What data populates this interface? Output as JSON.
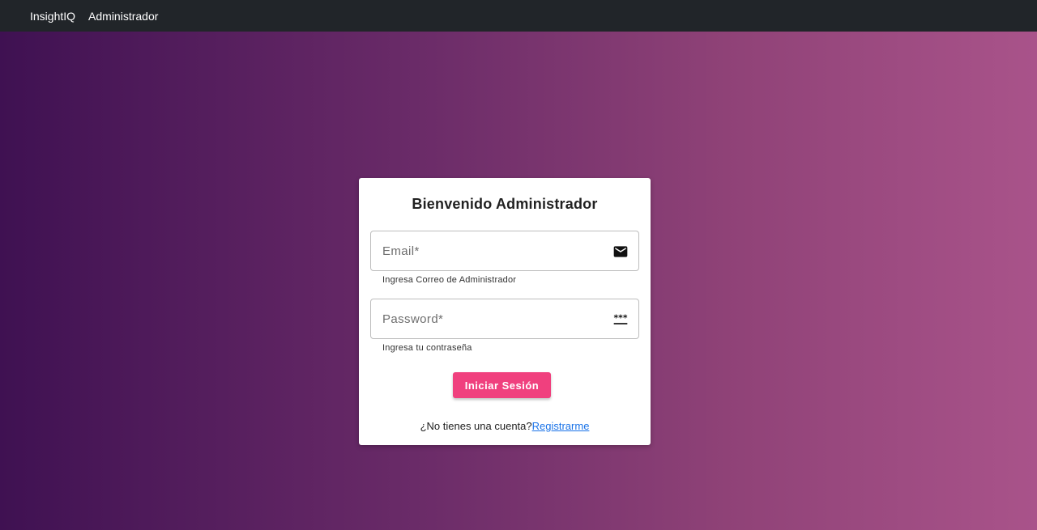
{
  "navbar": {
    "brand": "InsightIQ",
    "link": "Administrador"
  },
  "login_card": {
    "title": "Bienvenido Administrador",
    "email": {
      "placeholder": "Email*",
      "value": "",
      "helper": "Ingresa Correo de Administrador",
      "icon": "mail-icon"
    },
    "password": {
      "placeholder": "Password*",
      "value": "",
      "helper": "Ingresa tu contraseña",
      "icon": "password-icon"
    },
    "submit_label": "Iniciar Sesión",
    "signup_prompt": "¿No tienes una cuenta?",
    "signup_link": "Registrarme"
  },
  "colors": {
    "navbar": "#212529",
    "gradient_start": "#3f1152",
    "gradient_end": "#a9538a",
    "button": "#f0407e",
    "link": "#1a73e8"
  }
}
